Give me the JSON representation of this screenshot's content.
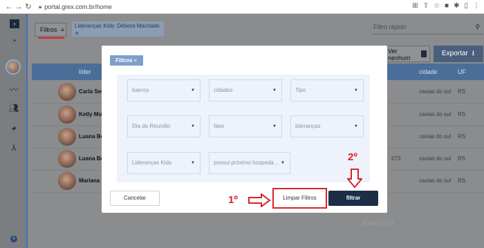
{
  "browser": {
    "url": "portal.grex.com.br/home"
  },
  "toolbar": {
    "filter_label": "Filtros",
    "chip_label": "Lideranças Kids: Débora Machado",
    "chip_close": "✕",
    "search_placeholder": "Filtro rápido",
    "map_label": "Ver nenhum mapa",
    "export_label": "Exportar"
  },
  "table": {
    "headers": [
      "líder",
      "cidade",
      "UF"
    ],
    "rows": [
      {
        "name": "Carla Seib",
        "city": "caxias do sul",
        "uf": "RS",
        "num": ""
      },
      {
        "name": "Ketly Mor",
        "city": "caxias do sul",
        "uf": "RS",
        "num": ""
      },
      {
        "name": "Luana Be",
        "city": "caxias do sul",
        "uf": "RS",
        "num": ""
      },
      {
        "name": "Luana Be",
        "city": "caxias do sul",
        "uf": "RS",
        "num": "673"
      },
      {
        "name": "Mariana C",
        "city": "caxias do sul",
        "uf": "RS",
        "num": ""
      }
    ]
  },
  "watermark": "Ativar o W",
  "modal": {
    "title": "Filtros",
    "selects": [
      "bairros",
      "cidades",
      "Tipo",
      "Dia da Reunião",
      "fase",
      "lideranças",
      "Lideranças Kids",
      "possui próximo hospeda..."
    ],
    "cancel_label": "Cancelar",
    "clear_label": "Limpar Filtros",
    "filter_label": "filtrar"
  },
  "annotations": {
    "step1": "1º",
    "step2": "2º"
  },
  "colors": {
    "accent_red": "#d8202a",
    "primary_dark": "#1c2d46",
    "header_blue": "#4b6e99"
  }
}
